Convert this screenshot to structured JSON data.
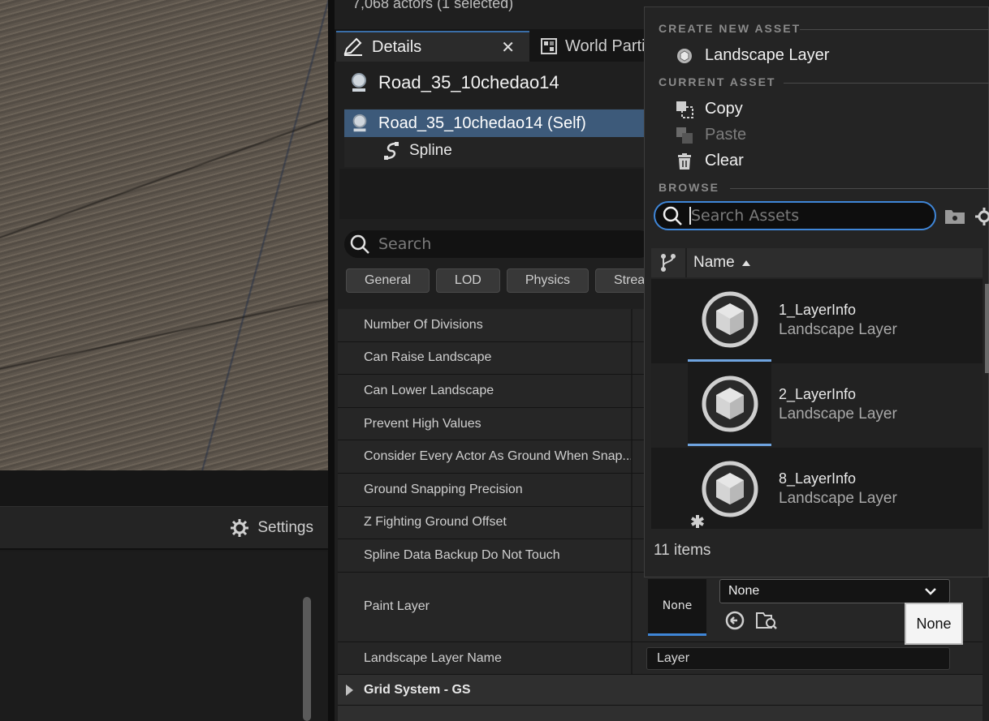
{
  "viewport": {
    "settings_label": "Settings"
  },
  "outliner": {
    "actor_count": "7,068 actors (1 selected)"
  },
  "tabs": {
    "details": "Details",
    "world_partition": "World Parti"
  },
  "actor": {
    "name": "Road_35_10chedao14",
    "self_label": "Road_35_10chedao14 (Self)",
    "component": "Spline"
  },
  "search": {
    "placeholder": "Search"
  },
  "filters": [
    "General",
    "LOD",
    "Physics",
    "Strea"
  ],
  "properties": [
    "Number Of Divisions",
    "Can Raise Landscape",
    "Can Lower Landscape",
    "Prevent High Values",
    "Consider Every Actor As Ground When Snap...",
    "Ground Snapping Precision",
    "Z Fighting Ground Offset",
    "Spline Data Backup Do Not Touch"
  ],
  "paint_layer": {
    "label": "Paint Layer",
    "thumb": "None",
    "value": "None",
    "tooltip": "None"
  },
  "layer_name": {
    "label": "Landscape Layer Name",
    "value": "Layer"
  },
  "sections": [
    "Grid System - GS"
  ],
  "picker": {
    "create_header": "CREATE NEW ASSET",
    "create_item": "Landscape Layer",
    "current_header": "CURRENT ASSET",
    "copy": "Copy",
    "paste": "Paste",
    "clear": "Clear",
    "browse_header": "BROWSE",
    "search_placeholder": "Search Assets",
    "column_name": "Name",
    "assets": [
      {
        "name": "1_LayerInfo",
        "type": "Landscape Layer"
      },
      {
        "name": "2_LayerInfo",
        "type": "Landscape Layer"
      },
      {
        "name": "8_LayerInfo",
        "type": "Landscape Layer"
      }
    ],
    "count": "11 items"
  },
  "colors": {
    "accent": "#3f86d8",
    "selection": "#3d5a7a"
  }
}
